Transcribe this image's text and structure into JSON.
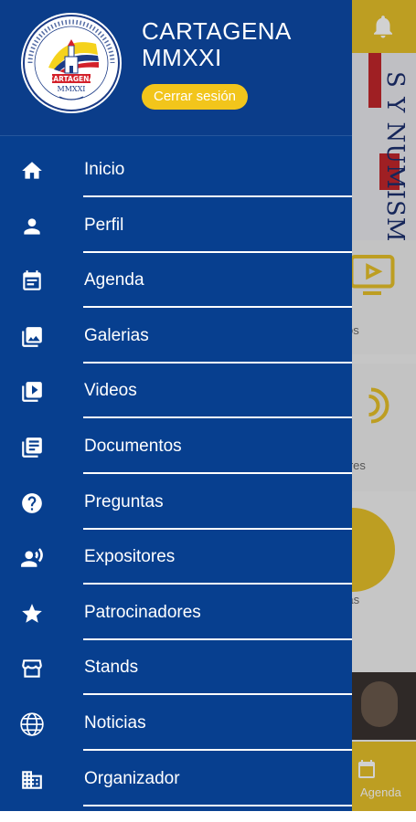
{
  "drawer": {
    "title_line1": "CARTAGENA",
    "title_line2": "MMXXI",
    "logout_label": "Cerrar sesión",
    "logo": {
      "top_ring_text": "FERIA INTERNACIONAL DE ANTIGÜEDADES",
      "center_text": "CARTAGENA",
      "year_text": "MMXXI"
    },
    "items": [
      {
        "label": "Inicio",
        "icon": "home-icon"
      },
      {
        "label": "Perfil",
        "icon": "person-icon"
      },
      {
        "label": "Agenda",
        "icon": "event-note-icon"
      },
      {
        "label": "Galerias",
        "icon": "photo-library-icon"
      },
      {
        "label": "Videos",
        "icon": "video-library-icon"
      },
      {
        "label": "Documentos",
        "icon": "library-books-icon"
      },
      {
        "label": "Preguntas",
        "icon": "help-icon"
      },
      {
        "label": "Expositores",
        "icon": "record-voice-icon"
      },
      {
        "label": "Patrocinadores",
        "icon": "star-icon"
      },
      {
        "label": "Stands",
        "icon": "storefront-icon"
      },
      {
        "label": "Noticias",
        "icon": "globe-icon"
      },
      {
        "label": "Organizador",
        "icon": "business-icon"
      }
    ]
  },
  "background": {
    "banner_text": "S Y NUMISM",
    "tile_labels": [
      "os",
      "tores",
      "cias"
    ],
    "bottom_nav_label": "Agenda"
  },
  "colors": {
    "drawer_bg": "#073f8f",
    "accent_yellow": "#f2c51b",
    "text_white": "#ffffff"
  }
}
